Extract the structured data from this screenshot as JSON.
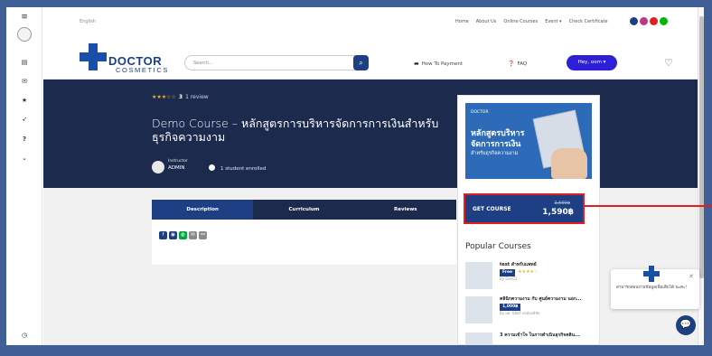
{
  "topbar": {
    "language": "English",
    "nav": [
      "Home",
      "About Us",
      "Online Courses",
      "Event ▾",
      "Check Certificate"
    ]
  },
  "brand": {
    "name_line1": "DOCTOR",
    "name_line2": "COSMETICS",
    "reg": "®"
  },
  "header": {
    "search_placeholder": "Search...",
    "how_to_pay": "How To Payment",
    "faq": "FAQ",
    "user_button": "Hey, oom ▾"
  },
  "course": {
    "rating_stars": "★★★☆☆",
    "rating_value": "3",
    "review_count": "1 review",
    "title": "Demo Course – หลักสูตรการบริหารจัดการการเงินสำหรับธุรกิจความงาม",
    "instructor_label": "Instructor",
    "instructor_name": "ADMIN",
    "enrolled": "1 student enrolled"
  },
  "tabs": [
    {
      "label": "Description",
      "active": true
    },
    {
      "label": "Curriculum",
      "active": false
    },
    {
      "label": "Reviews",
      "active": false
    }
  ],
  "share_icons": [
    "facebook-icon",
    "messenger-icon",
    "line-icon",
    "email-icon",
    "link-icon"
  ],
  "sidebar_card": {
    "thumb_brand": "DOCTOR",
    "thumb_line1": "หลักสูตรบริหาร",
    "thumb_line2": "จัดการการเงิน",
    "thumb_line3": "สำหรับธุรกิจความงาม",
    "get_course": "GET COURSE",
    "old_price": "1,590฿",
    "price": "1,590฿",
    "popular_heading": "Popular Courses",
    "popular": [
      {
        "title": "test สำหรับแพทย์",
        "badge": "Free",
        "stars": "★★★★☆",
        "by": "By Dev01"
      },
      {
        "title": "คลินิกความงาม กับ ศูนย์ความงาม นอก...",
        "badge": "1,000฿",
        "stars": "",
        "by": "By ผศ. นิธิศร์ พรตัณฑ์ชัย"
      },
      {
        "title": "3 ความเข้าใจ ในการดำเนินธุรกิจคลิน...",
        "badge": "",
        "stars": "",
        "by": ""
      }
    ]
  },
  "popup": {
    "text": "สามารถสอบถามข้อมูลเพิ่มเติมได้ นะคะ!"
  },
  "colors": {
    "navy": "#1c2b4d",
    "accent": "#1e3f84",
    "highlight": "#e02020",
    "user_button": "#2d1fd8"
  }
}
